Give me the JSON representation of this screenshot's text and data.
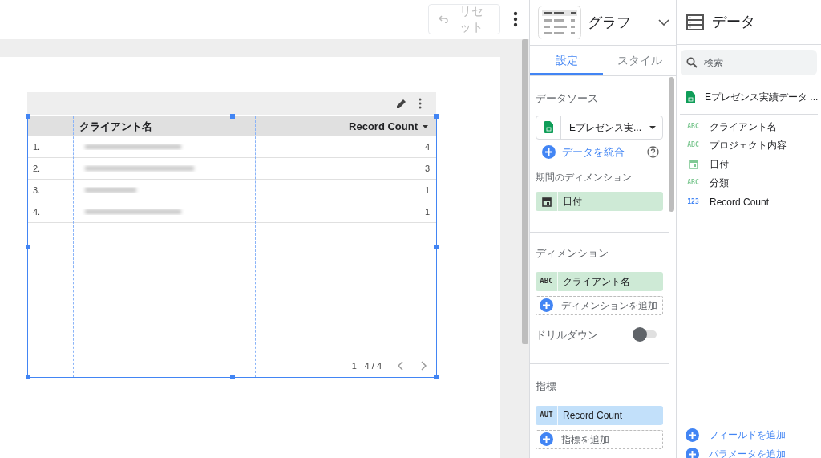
{
  "toolbar": {
    "reset_button": {
      "label": "リセット",
      "disabled": true
    }
  },
  "table": {
    "columns": [
      {
        "label": "クライアント名"
      },
      {
        "label": "Record Count",
        "sorted": true
      }
    ],
    "rows": [
      {
        "index": "1.",
        "count": "4"
      },
      {
        "index": "2.",
        "count": "3"
      },
      {
        "index": "3.",
        "count": "1"
      },
      {
        "index": "4.",
        "count": "1"
      }
    ],
    "pagination": "1 - 4 / 4"
  },
  "properties": {
    "title": "グラフ",
    "tabs": [
      {
        "label": "設定",
        "selected": true
      },
      {
        "label": "スタイル",
        "selected": false
      }
    ],
    "data_source": {
      "heading": "データソース",
      "value": "Eプレゼンス実...",
      "blend": "データを統合"
    },
    "date_dimension": {
      "heading": "期間のディメンション",
      "field": {
        "kind": "date",
        "label": "日付"
      }
    },
    "dimension": {
      "heading": "ディメンション",
      "field": {
        "kind": "text",
        "badge": "ABC",
        "label": "クライアント名"
      },
      "add": "ディメンションを追加"
    },
    "drilldown": {
      "label": "ドリルダウン",
      "on": false
    },
    "metric": {
      "heading": "指標",
      "field": {
        "kind": "number",
        "badge": "AUT",
        "label": "Record Count"
      },
      "add": "指標を追加"
    }
  },
  "data": {
    "title": "データ",
    "search_placeholder": "検索",
    "source": "Eプレゼンス実績データ ...",
    "fields": [
      {
        "kind": "text",
        "badge": "ABC",
        "label": "クライアント名"
      },
      {
        "kind": "text",
        "badge": "ABC",
        "label": "プロジェクト内容"
      },
      {
        "kind": "date",
        "label": "日付"
      },
      {
        "kind": "text",
        "badge": "ABC",
        "label": "分類"
      },
      {
        "kind": "number",
        "badge": "123",
        "label": "Record Count"
      }
    ],
    "add_field": "フィールドを追加",
    "add_parameter": "パラメータを追加"
  }
}
